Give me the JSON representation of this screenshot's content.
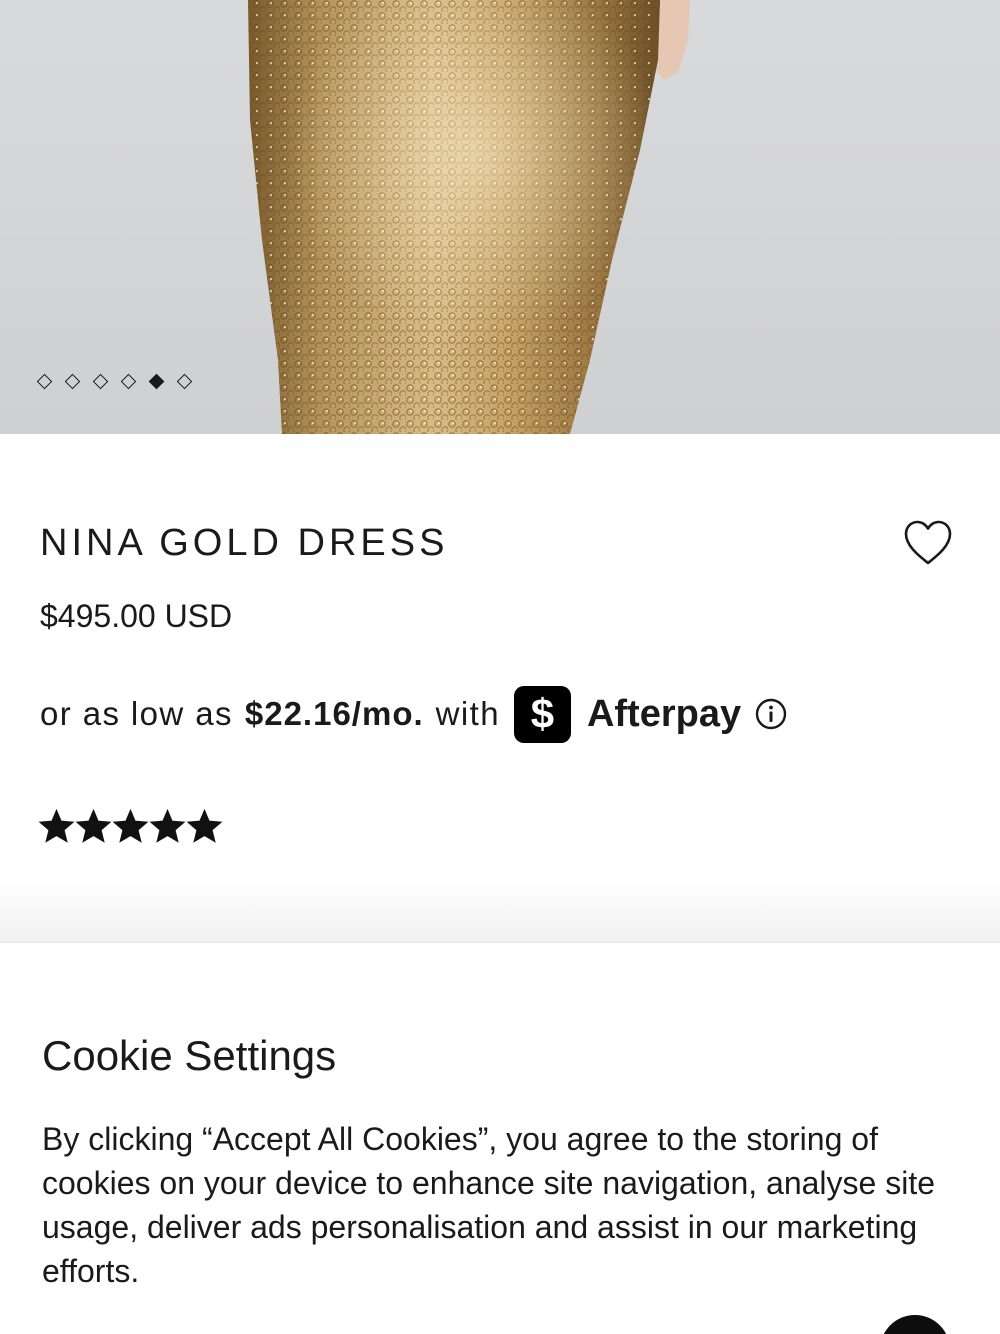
{
  "product": {
    "image_alt": "Gold sequin dress",
    "gallery": {
      "count": 6,
      "active_index": 4
    },
    "title": "NINA GOLD DRESS",
    "price": "$495.00 USD",
    "afterpay": {
      "prefix": "or as low as",
      "amount": "$22.16/mo.",
      "with": "with",
      "badge_symbol": "$",
      "brand": "Afterpay"
    },
    "rating": {
      "stars": 5,
      "max": 5
    }
  },
  "cookie_banner": {
    "title": "Cookie Settings",
    "body": "By clicking “Accept All Cookies”, you agree to the storing of cookies on your device to enhance site navigation, analyse site usage, deliver ads personalisation and assist in our marketing efforts."
  },
  "icons": {
    "wishlist": "heart-outline-icon",
    "info": "info-circle-icon",
    "star": "star-filled-icon"
  },
  "colors": {
    "text": "#1a1a1a",
    "dress_gold": "#b08a4c",
    "image_bg": "#d5d6d8",
    "badge_bg": "#000000"
  }
}
